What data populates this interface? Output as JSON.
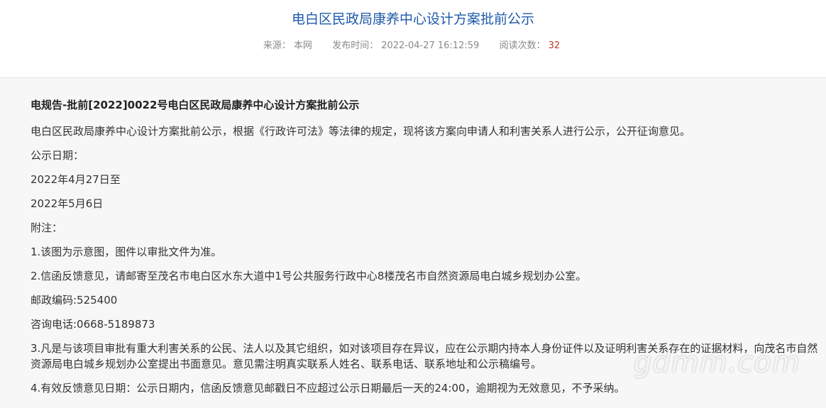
{
  "header": {
    "title": "电白区民政局康养中心设计方案批前公示",
    "source_label": "来源：",
    "source_value": "本网",
    "published_label": "发布时间：",
    "published_value": "2022-04-27 16:12:59",
    "views_label": "阅读次数：",
    "views_value": "32"
  },
  "article": {
    "heading": "电规告-批前[2022]0022号电白区民政局康养中心设计方案批前公示",
    "paragraphs": [
      "电白区民政局康养中心设计方案批前公示，根据《行政许可法》等法律的规定，现将该方案向申请人和利害关系人进行公示，公开征询意见。",
      "公示日期：",
      "2022年4月27日至",
      "2022年5月6日",
      "附注：",
      "1.该图为示意图，图件以审批文件为准。",
      "2.信函反馈意见，请邮寄至茂名市电白区水东大道中1号公共服务行政中心8楼茂名市自然资源局电白城乡规划办公室。",
      "邮政编码:525400",
      "咨询电话:0668-5189873",
      "3.凡是与该项目审批有重大利害关系的公民、法人以及其它组织，如对该项目存在异议，应在公示期内持本人身份证件以及证明利害关系存在的证据材料，向茂名市自然资源局电白城乡规划办公室提出书面意见。意见需注明真实联系人姓名、联系电话、联系地址和公示稿编号。",
      "4.有效反馈意见日期：公示日期内，信函反馈意见邮戳日不应超过公示日期最后一天的24:00，逾期视为无效意见，不予采纳。"
    ]
  },
  "watermark": "gdmm.com",
  "colors": {
    "title": "#1e5aa8",
    "meta": "#8a8a8a",
    "count": "#c0392b",
    "content_bg": "#f7f7f7"
  }
}
